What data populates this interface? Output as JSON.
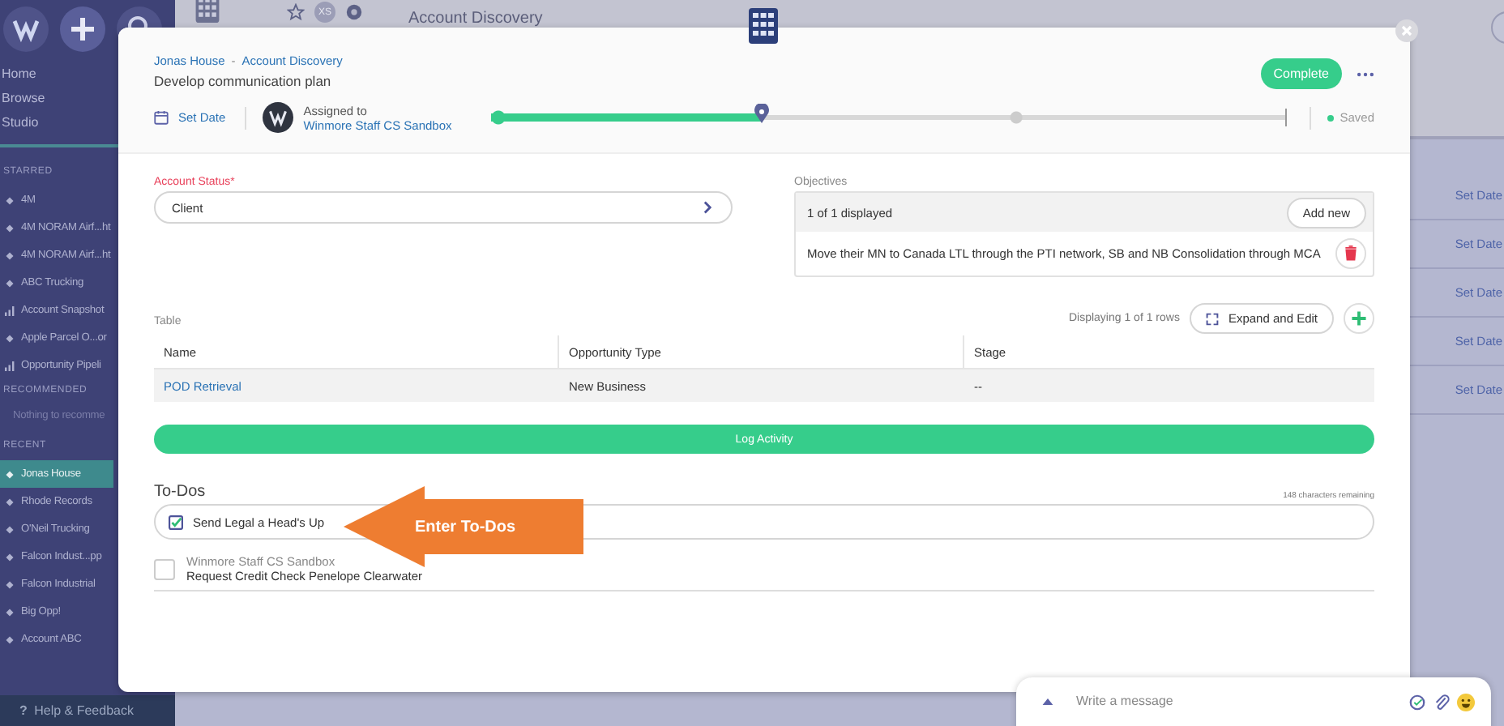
{
  "sidebar": {
    "nav": [
      "Home",
      "Browse",
      "Studio"
    ],
    "sections": [
      {
        "title": "STARRED",
        "items": [
          {
            "label": "4M",
            "kind": "record",
            "selected": false
          },
          {
            "label": "4M NORAM Airf...ht",
            "kind": "record",
            "selected": false
          },
          {
            "label": "4M NORAM Airf...ht",
            "kind": "record",
            "selected": false
          },
          {
            "label": "ABC Trucking",
            "kind": "record",
            "selected": false
          },
          {
            "label": "Account Snapshot",
            "kind": "report",
            "selected": false
          },
          {
            "label": "Apple Parcel O...or",
            "kind": "record",
            "selected": false
          },
          {
            "label": "Opportunity Pipeli",
            "kind": "report",
            "selected": false
          }
        ]
      },
      {
        "title": "RECOMMENDED",
        "empty_text": "Nothing to recomme"
      },
      {
        "title": "RECENT",
        "items": [
          {
            "label": "Jonas House",
            "kind": "record",
            "selected": true
          },
          {
            "label": "Rhode Records",
            "kind": "record",
            "selected": false
          },
          {
            "label": "O'Neil Trucking",
            "kind": "record",
            "selected": false
          },
          {
            "label": "Falcon Indust...pp",
            "kind": "record",
            "selected": false
          },
          {
            "label": "Falcon Industrial",
            "kind": "record",
            "selected": false
          },
          {
            "label": "Big Opp!",
            "kind": "record",
            "selected": false
          },
          {
            "label": "Account ABC",
            "kind": "record",
            "selected": false
          }
        ]
      }
    ],
    "help_icon": "?",
    "help": "Help & Feedback"
  },
  "topbar": {
    "badge": "XS",
    "title": "Account Discovery"
  },
  "background_rows": [
    {
      "action": "Set Date"
    },
    {
      "action": "Set Date"
    },
    {
      "action": "Set Date"
    },
    {
      "action": "Set Date"
    },
    {
      "action": "Set Date"
    }
  ],
  "modal": {
    "breadcrumb": [
      "Jonas House",
      "Account Discovery"
    ],
    "breadcrumb_separator": "-",
    "title": "Develop communication plan",
    "complete_button": "Complete",
    "set_date": "Set Date",
    "assigned_label": "Assigned to",
    "assignee": "Winmore Staff CS Sandbox",
    "progress": {
      "level": 0.34
    },
    "saved": "Saved",
    "account_status": {
      "label": "Account Status",
      "required": true,
      "required_mark": "*",
      "value": "Client"
    },
    "objectives": {
      "label": "Objectives",
      "count": "1 of 1 displayed",
      "add_button": "Add new",
      "items": [
        "Move their MN to Canada LTL through the PTI network, SB and NB Consolidation through MCA"
      ]
    },
    "table": {
      "label": "Table",
      "summary": "Displaying 1 of 1 rows",
      "expand_button": "Expand and Edit",
      "columns": [
        "Name",
        "Opportunity Type",
        "Stage"
      ],
      "rows": [
        [
          "POD Retrieval",
          "New Business",
          "--"
        ]
      ]
    },
    "log_button": "Log Activity",
    "todos": {
      "title": "To-Dos",
      "remaining": "148 characters remaining",
      "input_value": "Send Legal a Head's Up",
      "items": [
        {
          "owner": "Winmore Staff CS Sandbox",
          "text": "Request Credit Check Penelope Clearwater",
          "checked": false
        }
      ]
    }
  },
  "callout": {
    "text": "Enter To-Dos"
  },
  "chat": {
    "placeholder": "Write a message"
  }
}
